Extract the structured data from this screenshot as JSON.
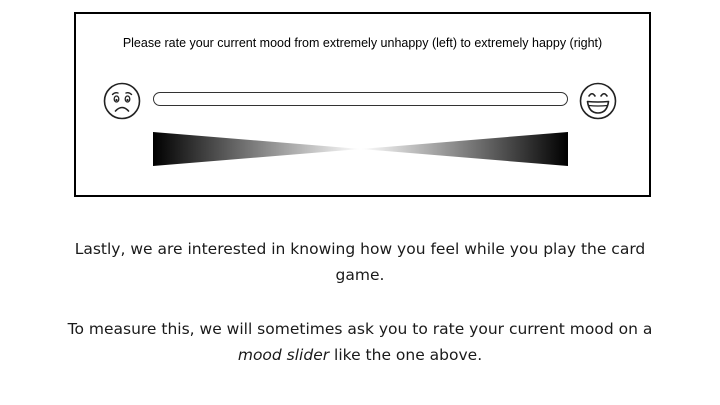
{
  "slider_panel": {
    "prompt": "Please rate your current mood from extremely unhappy (left) to extremely happy (right)",
    "left_icon": "sad-face-icon",
    "right_icon": "happy-face-icon"
  },
  "instructions": {
    "para1_line1": "Lastly, we are interested in knowing how you feel while you play the card",
    "para1_line2": "game.",
    "para2_line1": "To measure this, we will sometimes ask you to rate your current mood on a",
    "para2_emphasis": "mood slider",
    "para2_rest": " like the one above."
  }
}
